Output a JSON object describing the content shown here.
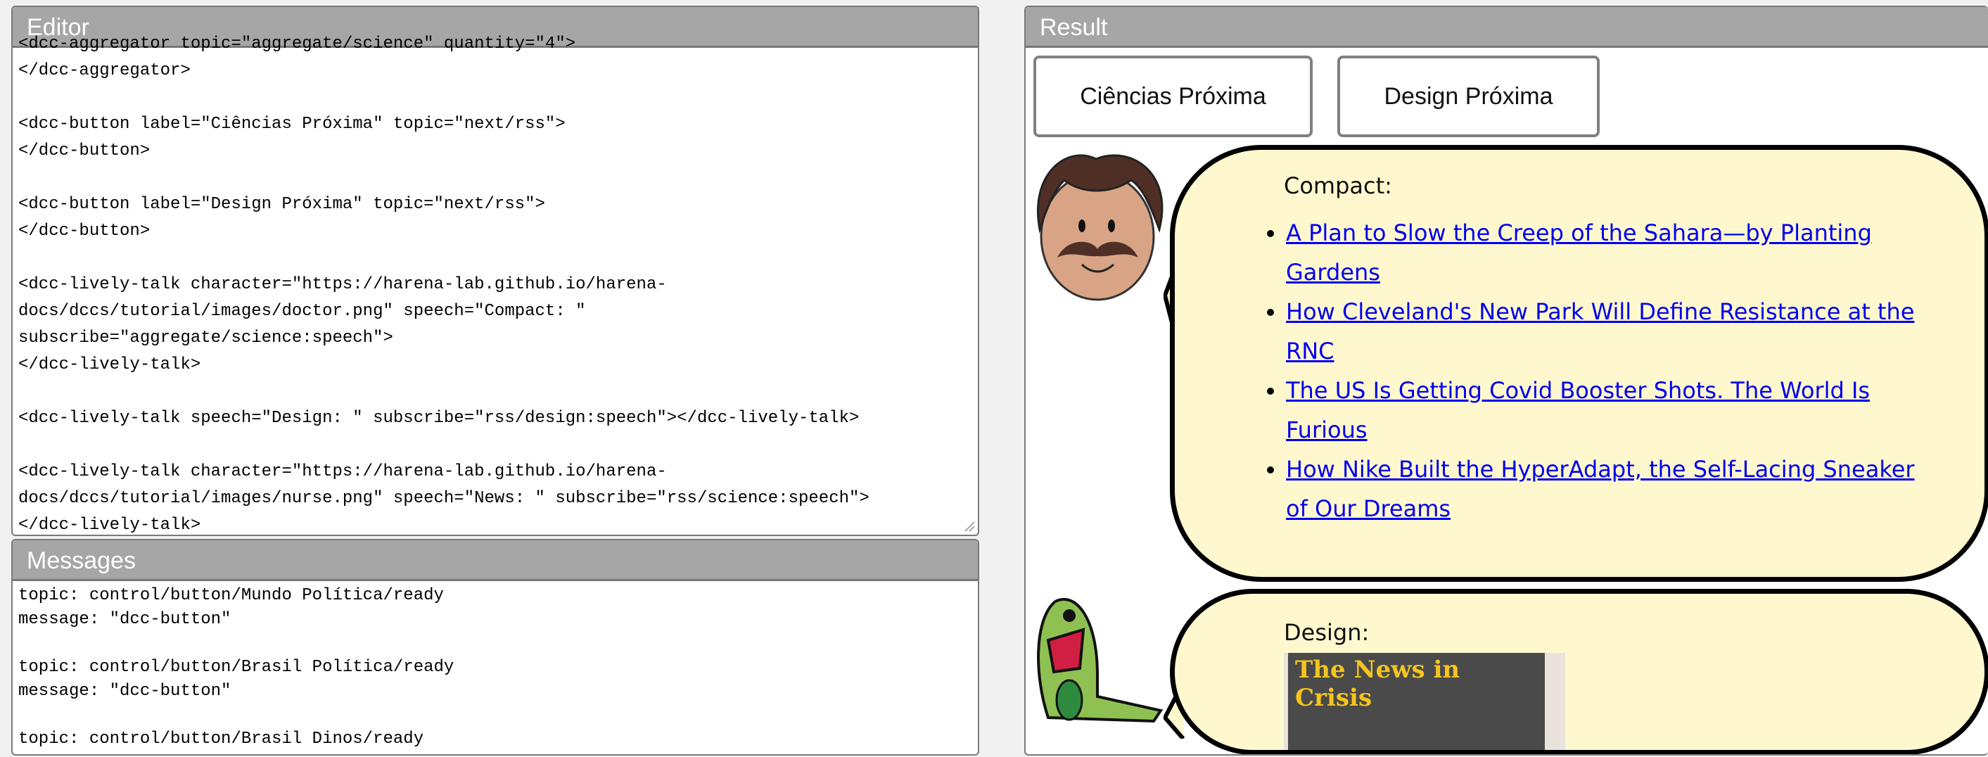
{
  "editor": {
    "title": "Editor",
    "lines": [
      "<dcc-aggregator topic=\"aggregate/science\" quantity=\"4\">",
      "</dcc-aggregator>",
      "",
      "<dcc-button label=\"Ciências Próxima\" topic=\"next/rss\">",
      "</dcc-button>",
      "",
      "<dcc-button label=\"Design Próxima\" topic=\"next/rss\">",
      "</dcc-button>",
      "",
      "<dcc-lively-talk character=\"https://harena-lab.github.io/harena-",
      "docs/dccs/tutorial/images/doctor.png\" speech=\"Compact: \"",
      "subscribe=\"aggregate/science:speech\">",
      "</dcc-lively-talk>",
      "",
      "<dcc-lively-talk speech=\"Design: \" subscribe=\"rss/design:speech\"></dcc-lively-talk>",
      "",
      "<dcc-lively-talk character=\"https://harena-lab.github.io/harena-",
      "docs/dccs/tutorial/images/nurse.png\" speech=\"News: \" subscribe=\"rss/science:speech\">",
      "</dcc-lively-talk>"
    ]
  },
  "messages": {
    "title": "Messages",
    "lines": [
      "topic: control/button/Mundo Política/ready",
      "message: \"dcc-button\"",
      "",
      "topic: control/button/Brasil Política/ready",
      "message: \"dcc-button\"",
      "",
      "topic: control/button/Brasil Dinos/ready"
    ]
  },
  "result": {
    "title": "Result",
    "buttons": [
      "Ciências Próxima",
      "Design Próxima"
    ],
    "talk1": {
      "speech": "Compact:",
      "links": [
        "A Plan to Slow the Creep of the Sahara—by Planting Gardens",
        "How Cleveland's New Park Will Define Resistance at the RNC",
        "The US Is Getting Covid Booster Shots. The World Is Furious",
        "How Nike Built the HyperAdapt, the Self-Lacing Sneaker of Our Dreams"
      ]
    },
    "talk2": {
      "speech": "Design:",
      "image_text": "The News in Crisis"
    }
  }
}
